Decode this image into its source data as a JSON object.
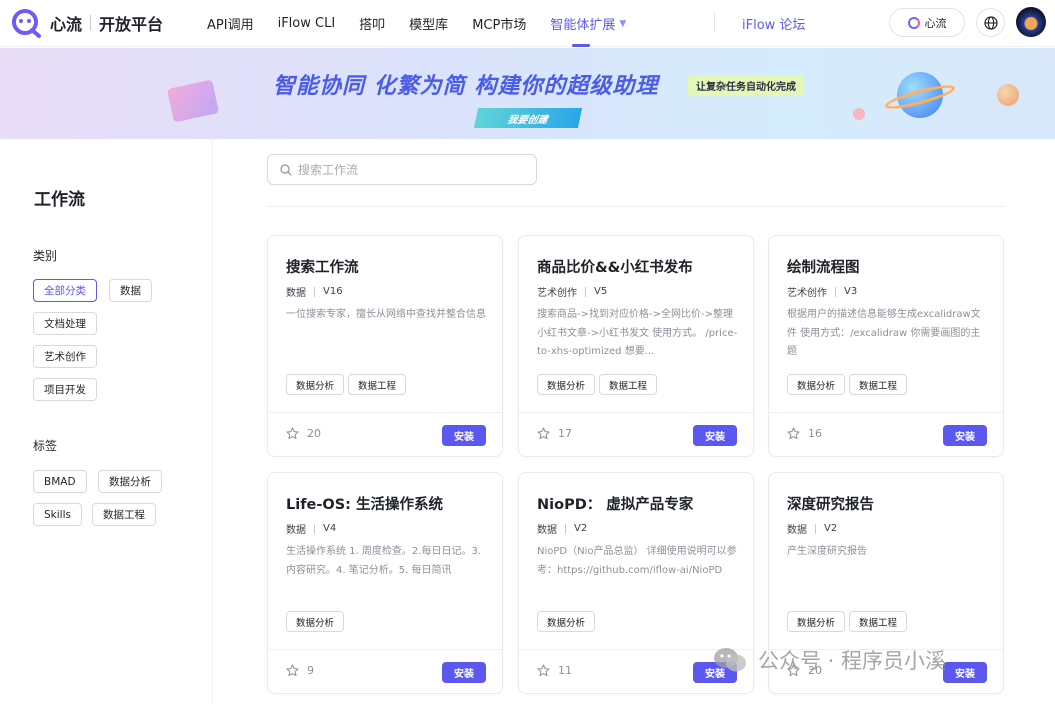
{
  "header": {
    "logo_text": "心流",
    "logo_sub": "开放平台",
    "nav": [
      {
        "label": "API调用",
        "active": false
      },
      {
        "label": "iFlow CLI",
        "active": false
      },
      {
        "label": "搭叩",
        "active": false
      },
      {
        "label": "模型库",
        "active": false
      },
      {
        "label": "MCP市场",
        "active": false
      },
      {
        "label": "智能体扩展",
        "active": true
      }
    ],
    "forum_label": "iFlow 论坛",
    "xinliu_button_label": "心流"
  },
  "banner": {
    "title": "智能协同  化繁为简  构建你的超级助理",
    "tag": "让复杂任务自动化完成",
    "button": "我要创建"
  },
  "sidebar": {
    "title": "工作流",
    "category_heading": "类别",
    "categories": [
      "全部分类",
      "数据",
      "文档处理",
      "艺术创作",
      "项目开发"
    ],
    "tag_heading": "标签",
    "tags": [
      "BMAD",
      "数据分析",
      "Skills",
      "数据工程"
    ]
  },
  "search": {
    "placeholder": "搜索工作流"
  },
  "cards": [
    {
      "title": "搜索工作流",
      "category": "数据",
      "version": "V16",
      "desc": "一位搜索专家，擅长从网络中查找并整合信息",
      "tags": [
        "数据分析",
        "数据工程"
      ],
      "stars": "20",
      "install": "安装"
    },
    {
      "title": "商品比价&&小红书发布",
      "category": "艺术创作",
      "version": "V5",
      "desc": "搜索商品->找到对应价格->全网比价->整理小红书文章->小红书发文 使用方式。 /price-to-xhs-optimized 想要...",
      "tags": [
        "数据分析",
        "数据工程"
      ],
      "stars": "17",
      "install": "安装"
    },
    {
      "title": "绘制流程图",
      "category": "艺术创作",
      "version": "V3",
      "desc": "根据用户的描述信息能够生成excalidraw文件 使用方式：/excalidraw 你需要画图的主题",
      "tags": [
        "数据分析",
        "数据工程"
      ],
      "stars": "16",
      "install": "安装"
    },
    {
      "title": "Life-OS: 生活操作系统",
      "category": "数据",
      "version": "V4",
      "desc": "生活操作系统 1. 周度检查。2.每日日记。3. 内容研究。4. 笔记分析。5. 每日简讯",
      "tags": [
        "数据分析"
      ],
      "stars": "9",
      "install": "安装"
    },
    {
      "title": "NioPD： 虚拟产品专家",
      "category": "数据",
      "version": "V2",
      "desc": "NioPD（Nio产品总监） 详细使用说明可以参考：https://github.com/iflow-ai/NioPD",
      "tags": [
        "数据分析"
      ],
      "stars": "11",
      "install": "安装"
    },
    {
      "title": "深度研究报告",
      "category": "数据",
      "version": "V2",
      "desc": "产生深度研究报告",
      "tags": [
        "数据分析",
        "数据工程"
      ],
      "stars": "20",
      "install": "安装"
    }
  ],
  "watermark": "公众号 · 程序员小溪",
  "colors": {
    "accent": "#5b5bf0",
    "install_button": "#5b57ef"
  }
}
